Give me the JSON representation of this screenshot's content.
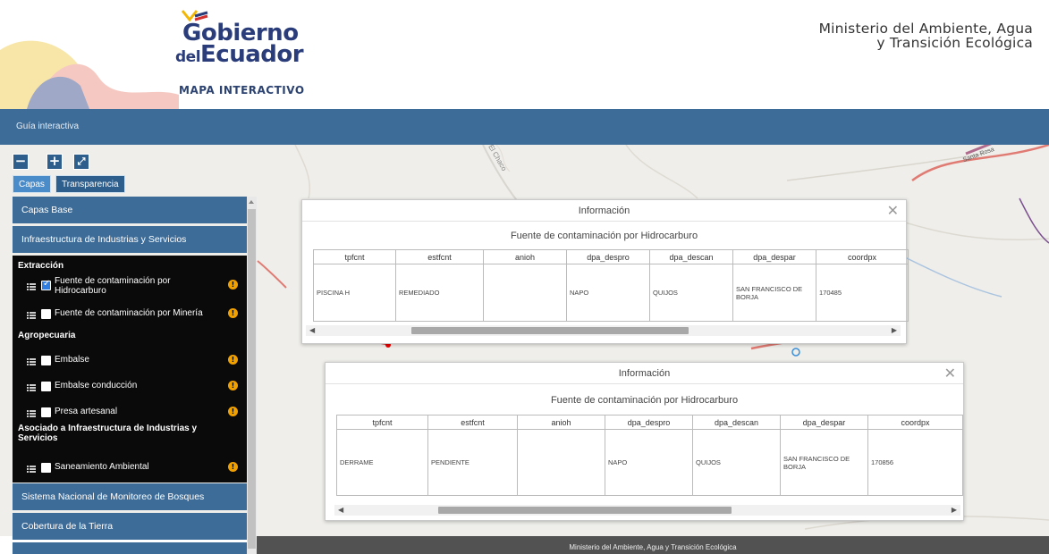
{
  "header": {
    "logo_line1": "Gobierno",
    "logo_line2_small": "del",
    "logo_line2": "Ecuador",
    "ministry_line1": "Ministerio del Ambiente, Agua",
    "ministry_line2": "y Transición Ecológica",
    "map_title": "MAPA INTERACTIVO"
  },
  "nav": {
    "guide_label": "Guía interactiva"
  },
  "map_controls": {
    "zoom_out": "−",
    "zoom_in": "+",
    "fullscreen": "⤢"
  },
  "tabs": [
    {
      "label": "Capas",
      "active": true
    },
    {
      "label": "Transparencia",
      "active": false
    }
  ],
  "panel": {
    "groups_top": [
      {
        "label": "Capas Base"
      },
      {
        "label": "Infraestructura de Industrias y Servicios"
      }
    ],
    "sections": [
      {
        "title": "Extracción",
        "layers": [
          {
            "label": "Fuente de contaminación por Hidrocarburo",
            "checked": true
          },
          {
            "label": "Fuente de contaminación por Minería",
            "checked": false
          }
        ]
      },
      {
        "title": "Agropecuaria",
        "layers": [
          {
            "label": "Embalse",
            "checked": false
          },
          {
            "label": "Embalse conducción",
            "checked": false
          },
          {
            "label": "Presa artesanal",
            "checked": false
          }
        ]
      },
      {
        "title": "Asociado a Infraestructura de Industrias y Servicios",
        "layers": [
          {
            "label": "Saneamiento Ambiental",
            "checked": false
          }
        ]
      }
    ],
    "groups_bottom": [
      {
        "label": "Sistema Nacional de Monitoreo de Bosques"
      },
      {
        "label": "Cobertura de la Tierra"
      }
    ]
  },
  "map_labels": {
    "road_1": "El Chaco",
    "road_2": "Santa Rosa"
  },
  "popups": [
    {
      "title": "Información",
      "subtitle": "Fuente de contaminación por Hidrocarburo",
      "columns": [
        "tpfcnt",
        "estfcnt",
        "anioh",
        "dpa_despro",
        "dpa_descan",
        "dpa_despar",
        "coordpx"
      ],
      "row": [
        "PISCINA H",
        "REMEDIADO",
        "",
        "NAPO",
        "QUIJOS",
        "SAN FRANCISCO DE BORJA",
        "170485"
      ]
    },
    {
      "title": "Información",
      "subtitle": "Fuente de contaminación por Hidrocarburo",
      "columns": [
        "tpfcnt",
        "estfcnt",
        "anioh",
        "dpa_despro",
        "dpa_descan",
        "dpa_despar",
        "coordpx"
      ],
      "row": [
        "DERRAME",
        "PENDIENTE",
        "",
        "NAPO",
        "QUIJOS",
        "SAN FRANCISCO DE BORJA",
        "170856"
      ]
    }
  ],
  "footer": {
    "text": "Ministerio del Ambiente, Agua y Transición Ecológica"
  },
  "colors": {
    "nav": "#3d6c98",
    "panel_dark": "#0a0a0a",
    "info_dot": "#f0a000",
    "footer": "#525252"
  }
}
